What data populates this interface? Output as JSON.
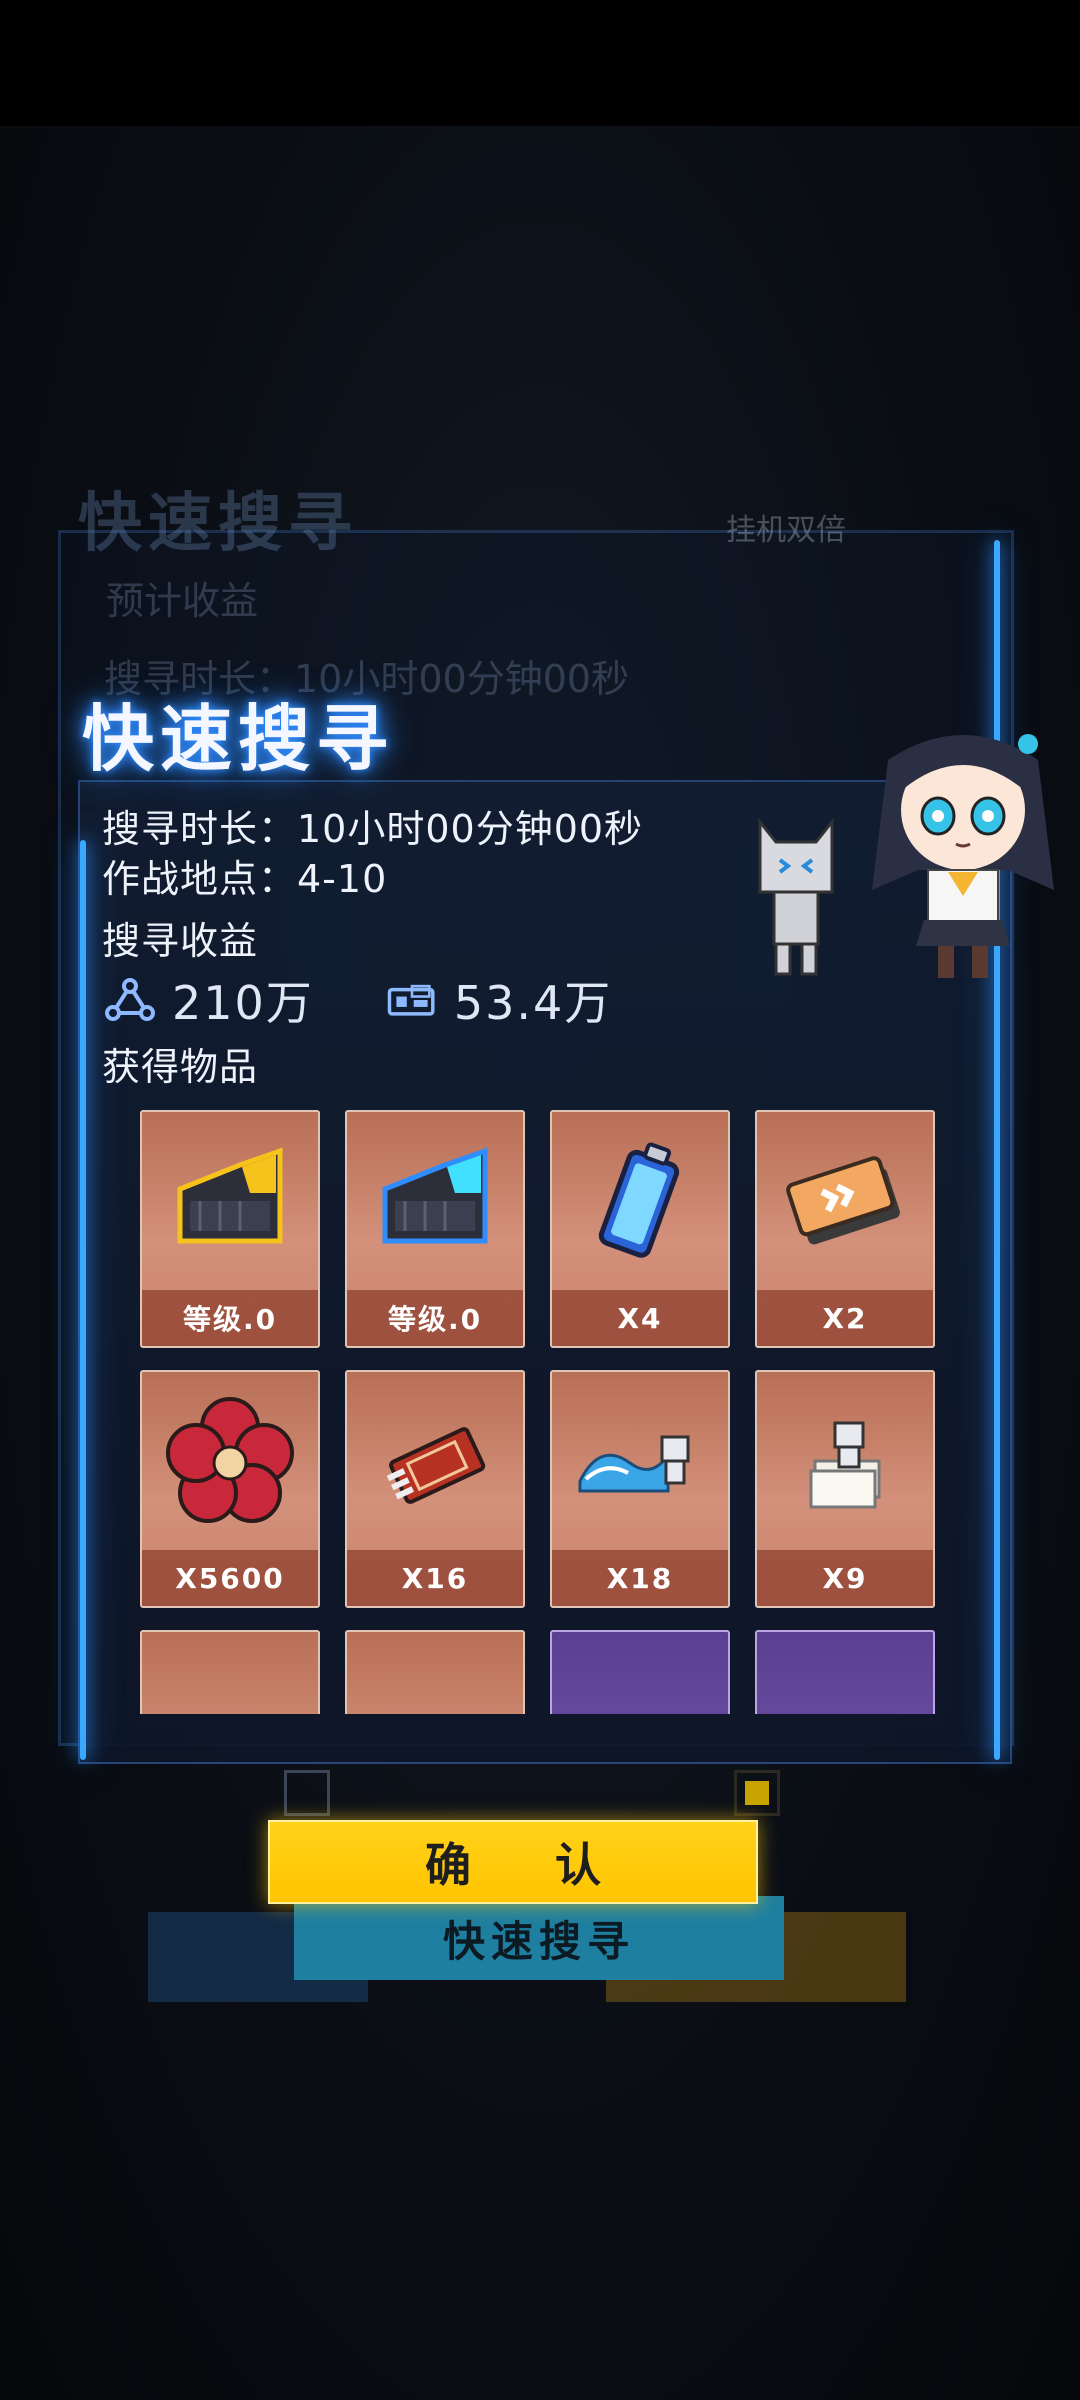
{
  "dialog": {
    "title": "快速搜寻",
    "duration": "搜寻时长：10小时00分钟00秒",
    "location": "作战地点：4-10",
    "reward_section": "搜寻收益",
    "rewards": [
      {
        "icon": "network-node-icon",
        "value": "210万"
      },
      {
        "icon": "data-chip-icon",
        "value": "53.4万"
      }
    ],
    "items_section": "获得物品",
    "items": [
      {
        "icon": "yellow-fragment-icon",
        "label": "等级.0",
        "rarity": "orange"
      },
      {
        "icon": "cyan-fragment-icon",
        "label": "等级.0",
        "rarity": "orange"
      },
      {
        "icon": "battery-icon",
        "label": "X4",
        "rarity": "orange"
      },
      {
        "icon": "speedup-ticket-icon",
        "label": "X2",
        "rarity": "orange"
      },
      {
        "icon": "red-flower-icon",
        "label": "X5600",
        "rarity": "orange"
      },
      {
        "icon": "matchbox-icon",
        "label": "X16",
        "rarity": "orange"
      },
      {
        "icon": "wave-robot-icon",
        "label": "X18",
        "rarity": "orange"
      },
      {
        "icon": "paper-robot-icon",
        "label": "X9",
        "rarity": "orange"
      },
      {
        "icon": "partial-robot-icon",
        "label": "",
        "rarity": "orange"
      },
      {
        "icon": "partial-item-icon",
        "label": "",
        "rarity": "orange"
      },
      {
        "icon": "partial-shard-icon",
        "label": "",
        "rarity": "purple"
      },
      {
        "icon": "partial-chest-icon",
        "label": "",
        "rarity": "purple"
      }
    ],
    "confirm_label": "确 认"
  },
  "background": {
    "title": "快速搜寻",
    "expected_income": "预计收益",
    "duration": "搜寻时长：10小时00分钟00秒",
    "quick_search_button": "快速搜寻",
    "idle_double": "挂机双倍"
  },
  "colors": {
    "frame_glow": "#3aa8ff",
    "confirm_yellow": "#ffcc00",
    "card_orange": "#c9836c",
    "card_purple": "#6a4ca0"
  }
}
